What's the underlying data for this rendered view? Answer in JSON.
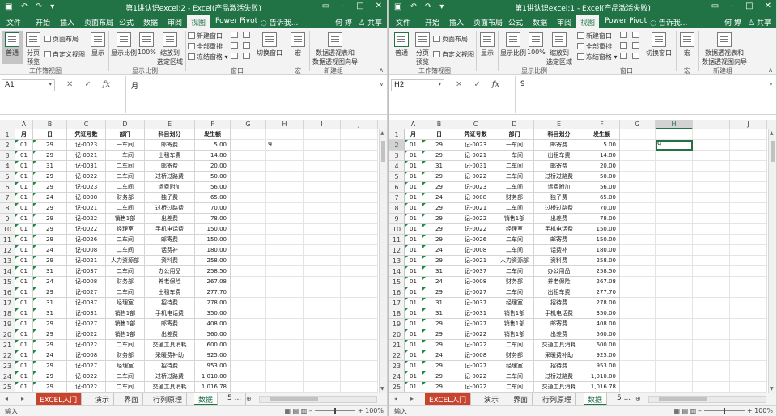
{
  "windows": [
    {
      "id": "win1",
      "title": "第1讲认识excel:2 - Excel(产品激活失败)",
      "user": "何 婷",
      "name_box": "A1",
      "formula": "月",
      "active_col": "",
      "active_row": 0,
      "extra_value": {
        "col": "H",
        "row": 2,
        "value": "9"
      },
      "view_button": "普通"
    },
    {
      "id": "win2",
      "title": "第1讲认识excel:1 - Excel(产品激活失败)",
      "user": "何 婷",
      "name_box": "H2",
      "formula": "9",
      "active_col": "H",
      "active_row": 2,
      "extra_value": {
        "col": "H",
        "row": 2,
        "value": "9"
      },
      "view_button": ""
    }
  ],
  "tabs": [
    "文件",
    "开始",
    "插入",
    "页面布局",
    "公式",
    "数据",
    "审阅",
    "视图",
    "Power Pivot"
  ],
  "active_tab": "视图",
  "tell_me": "告诉我...",
  "share": "共享",
  "ribbon": {
    "normal": "普通",
    "page_break_1": "分页",
    "page_break_2": "预览",
    "page_layout": "页面布局",
    "custom_view": "自定义视图",
    "show": "显示",
    "zoom": "显示比例",
    "zoom100": "100%",
    "zoom_sel_1": "缩放到",
    "zoom_sel_2": "选定区域",
    "new_window": "新建窗口",
    "arrange_all": "全部重排",
    "freeze_panes": "冻结窗格",
    "switch_windows": "切换窗口",
    "macros": "宏",
    "pivot_1": "数据透视表和",
    "pivot_2": "数据透视图向导",
    "grp_workbook": "工作簿视图",
    "grp_zoom": "显示比例",
    "grp_window": "窗口",
    "grp_macro": "宏",
    "grp_new": "新建组"
  },
  "columns": [
    "A",
    "B",
    "C",
    "D",
    "E",
    "F",
    "G",
    "H",
    "I",
    "J"
  ],
  "headers": [
    "月",
    "日",
    "凭证号数",
    "部门",
    "科目划分",
    "发生额"
  ],
  "rows": [
    [
      "01",
      "29",
      "记-0023",
      "一车间",
      "邮寄费",
      "5.00"
    ],
    [
      "01",
      "29",
      "记-0021",
      "一车间",
      "出租车费",
      "14.80"
    ],
    [
      "01",
      "31",
      "记-0031",
      "二车间",
      "邮寄费",
      "20.00"
    ],
    [
      "01",
      "29",
      "记-0022",
      "二车间",
      "过桥过路费",
      "50.00"
    ],
    [
      "01",
      "29",
      "记-0023",
      "二车间",
      "运费附加",
      "56.00"
    ],
    [
      "01",
      "24",
      "记-0008",
      "财务部",
      "独子费",
      "65.00"
    ],
    [
      "01",
      "29",
      "记-0021",
      "二车间",
      "过桥过路费",
      "70.00"
    ],
    [
      "01",
      "29",
      "记-0022",
      "销售1部",
      "出差费",
      "78.00"
    ],
    [
      "01",
      "29",
      "记-0022",
      "经理室",
      "手机电话费",
      "150.00"
    ],
    [
      "01",
      "29",
      "记-0026",
      "二车间",
      "邮寄费",
      "150.00"
    ],
    [
      "01",
      "24",
      "记-0008",
      "二车间",
      "话费补",
      "180.00"
    ],
    [
      "01",
      "29",
      "记-0021",
      "人力资源部",
      "资料费",
      "258.00"
    ],
    [
      "01",
      "31",
      "记-0037",
      "二车间",
      "办公用品",
      "258.50"
    ],
    [
      "01",
      "24",
      "记-0008",
      "财务部",
      "养老保险",
      "267.08"
    ],
    [
      "01",
      "29",
      "记-0027",
      "二车间",
      "出租车费",
      "277.70"
    ],
    [
      "01",
      "31",
      "记-0037",
      "经理室",
      "招待费",
      "278.00"
    ],
    [
      "01",
      "31",
      "记-0031",
      "销售1部",
      "手机电话费",
      "350.00"
    ],
    [
      "01",
      "29",
      "记-0027",
      "销售1部",
      "邮寄费",
      "408.00"
    ],
    [
      "01",
      "29",
      "记-0022",
      "销售1部",
      "出差费",
      "560.00"
    ],
    [
      "01",
      "29",
      "记-0022",
      "二车间",
      "交通工具消耗",
      "600.00"
    ],
    [
      "01",
      "24",
      "记-0008",
      "财务部",
      "采暖费补助",
      "925.00"
    ],
    [
      "01",
      "29",
      "记-0027",
      "经理室",
      "招待费",
      "953.00"
    ],
    [
      "01",
      "29",
      "记-0022",
      "二车间",
      "过桥过路费",
      "1,010.00"
    ],
    [
      "01",
      "29",
      "记-0022",
      "二车间",
      "交通工具消耗",
      "1,016.78"
    ]
  ],
  "sheet_tabs": [
    "EXCEL入门",
    "演示",
    "界面",
    "行列原理",
    "数据",
    "5 ..."
  ],
  "active_sheet": "数据",
  "status_left": "输入",
  "zoom_text": "100%"
}
